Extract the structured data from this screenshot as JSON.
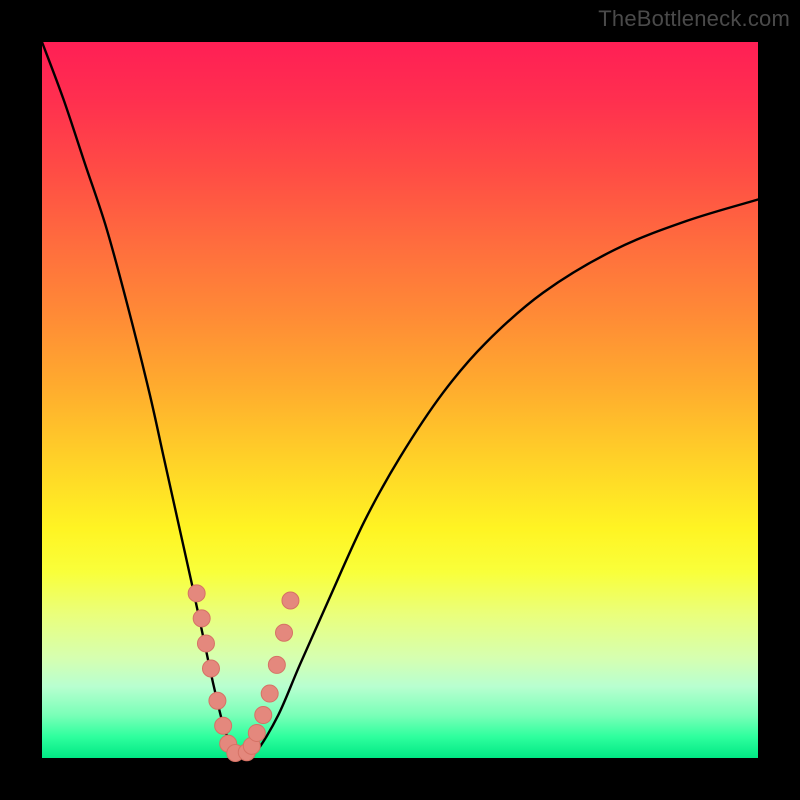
{
  "watermark": "TheBottleneck.com",
  "colors": {
    "frame": "#000000",
    "curve": "#000000",
    "dot_fill": "#e4887d",
    "dot_stroke": "#d67265"
  },
  "chart_data": {
    "type": "line",
    "title": "",
    "xlabel": "",
    "ylabel": "",
    "xlim": [
      0,
      100
    ],
    "ylim": [
      0,
      100
    ],
    "series": [
      {
        "name": "bottleneck-curve",
        "x": [
          0,
          3,
          6,
          9,
          12,
          15,
          17,
          19,
          21,
          22.5,
          24,
          25.5,
          27,
          28.5,
          30,
          33,
          36,
          40,
          45,
          50,
          56,
          62,
          70,
          80,
          90,
          100
        ],
        "y": [
          100,
          92,
          83,
          74,
          63,
          51,
          42,
          33,
          24,
          17,
          10,
          4,
          1,
          0.5,
          1,
          6,
          13,
          22,
          33,
          42,
          51,
          58,
          65,
          71,
          75,
          78
        ]
      }
    ],
    "markers": {
      "name": "highlighted-points",
      "x": [
        21.6,
        22.3,
        22.9,
        23.6,
        24.5,
        25.3,
        26.0,
        27.0,
        28.6,
        29.3,
        30.0,
        30.9,
        31.8,
        32.8,
        33.8,
        34.7
      ],
      "y": [
        23.0,
        19.5,
        16.0,
        12.5,
        8.0,
        4.5,
        2.0,
        0.7,
        0.8,
        1.7,
        3.5,
        6.0,
        9.0,
        13.0,
        17.5,
        22.0
      ]
    }
  }
}
